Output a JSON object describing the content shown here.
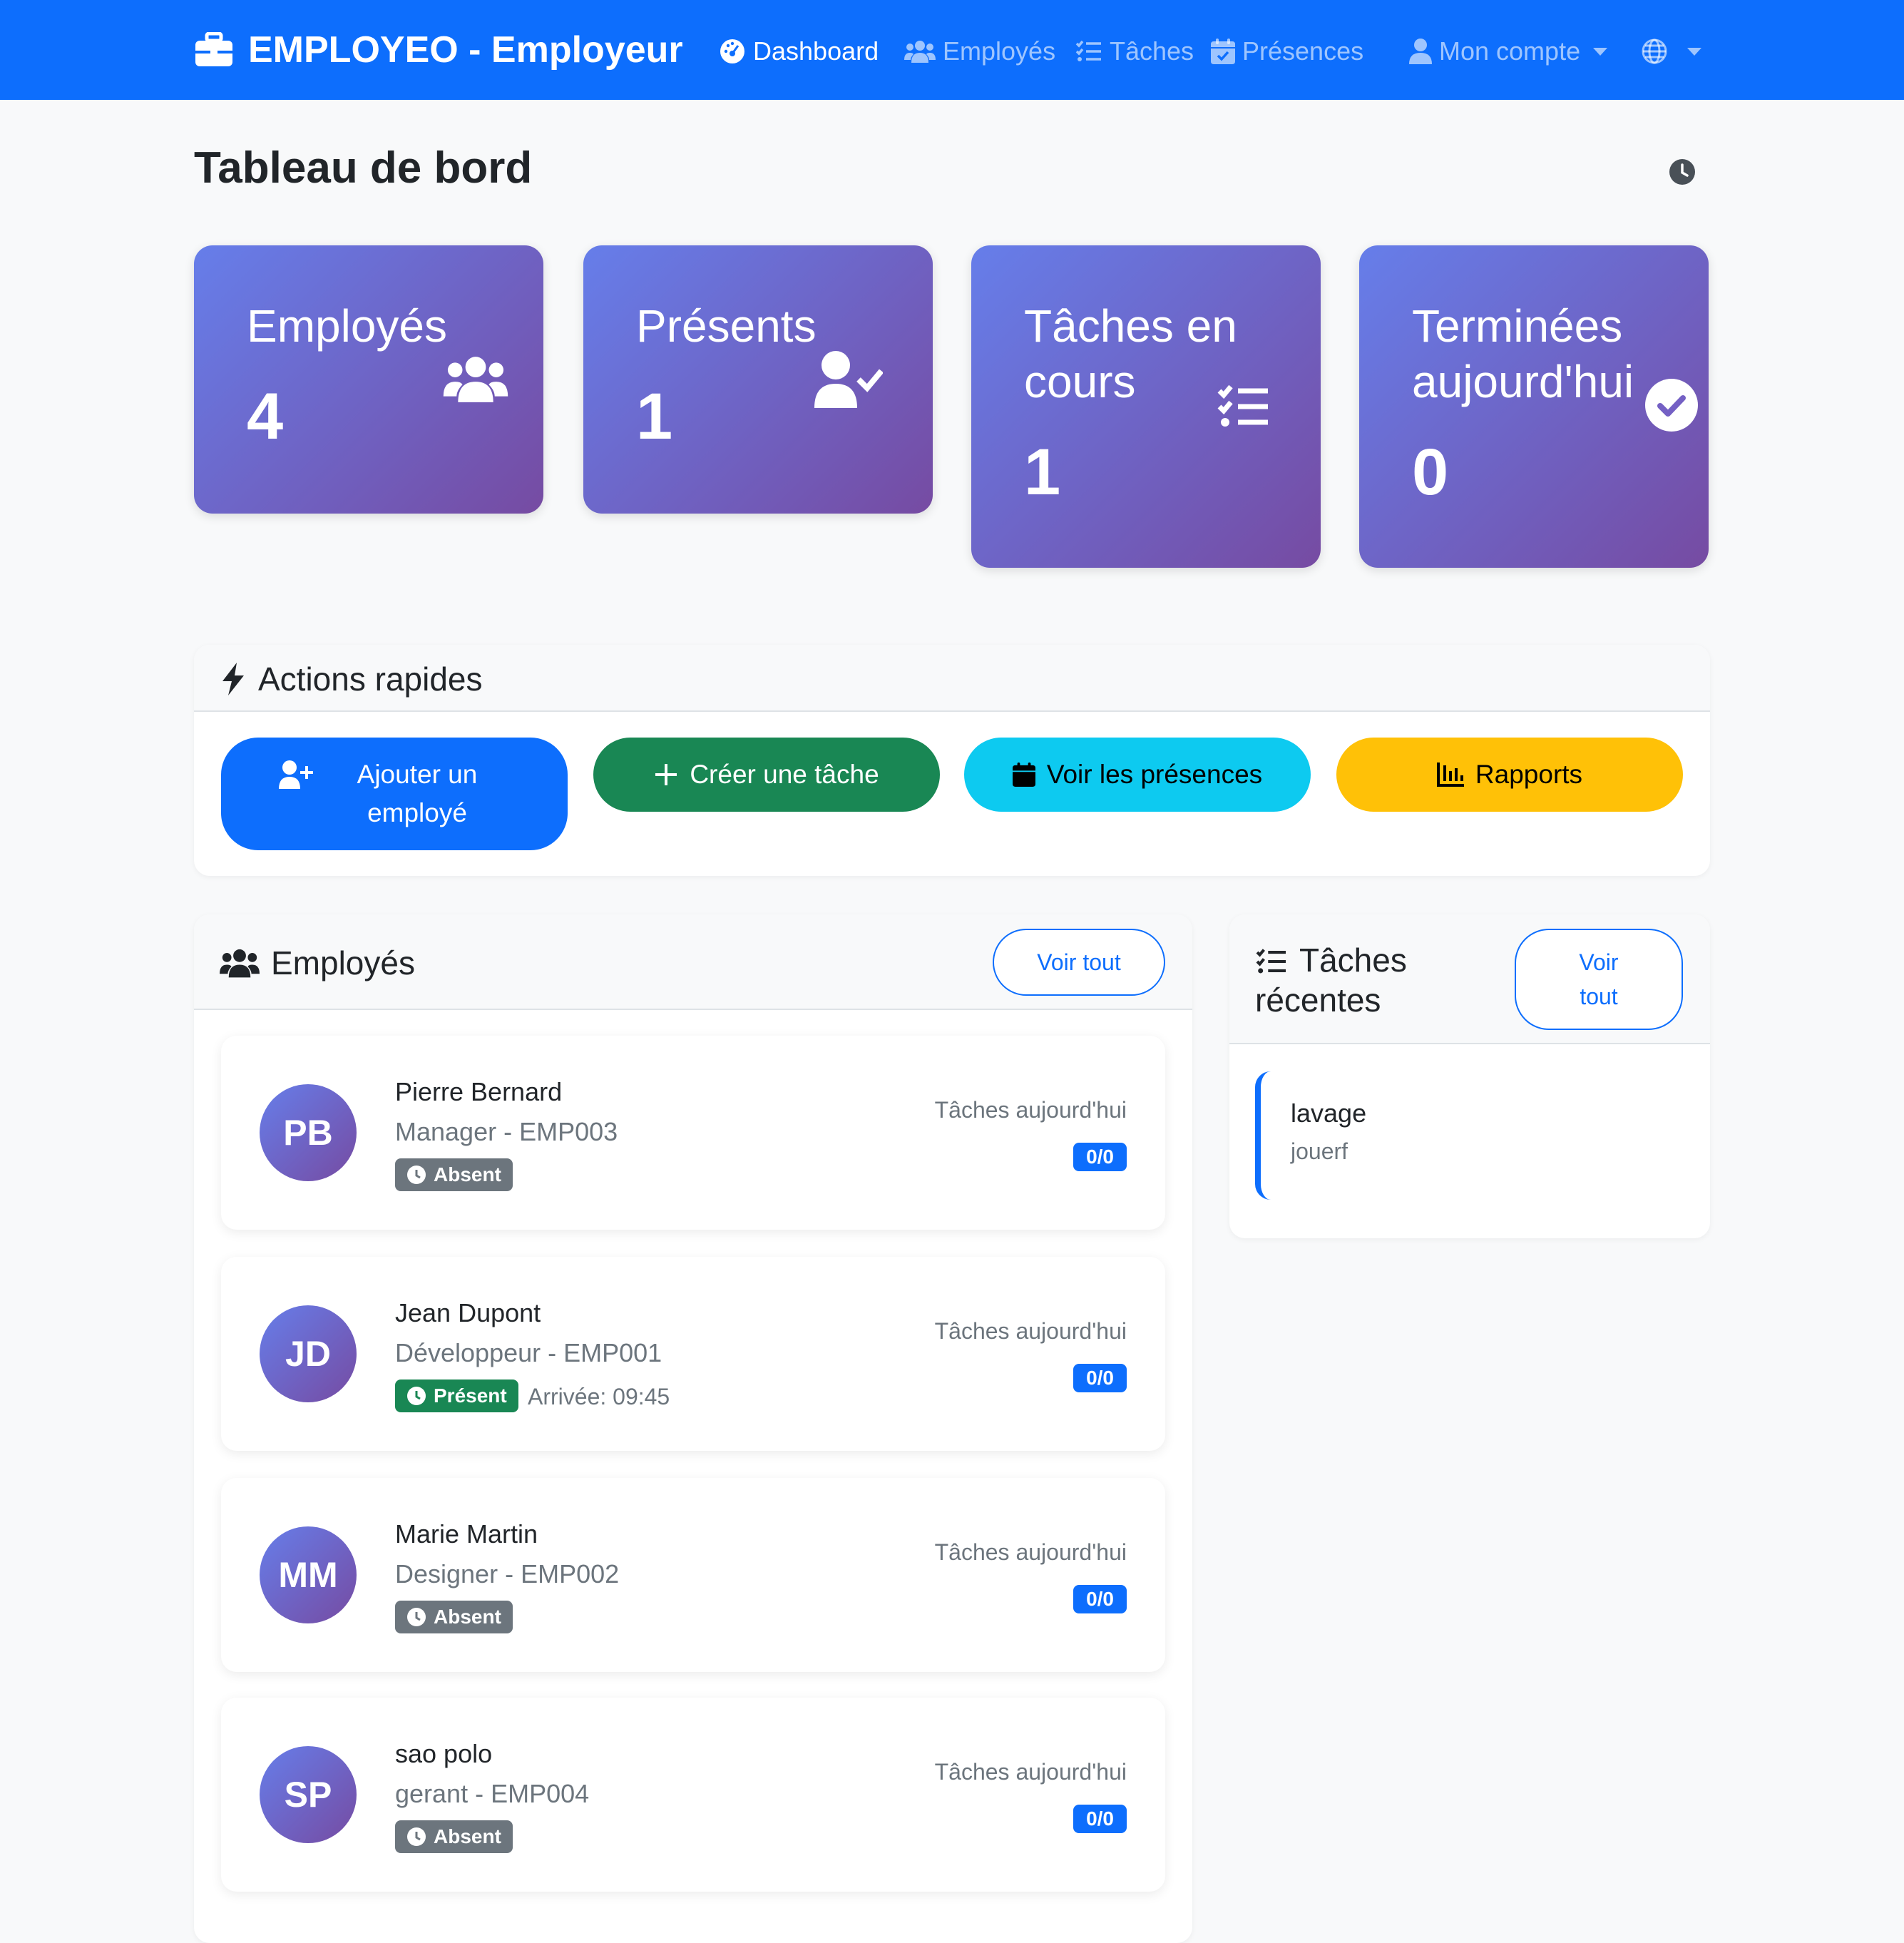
{
  "navbar": {
    "brand": "EMPLOYEO - Employeur",
    "links": [
      {
        "label": "Dashboard",
        "active": true
      },
      {
        "label": "Employés",
        "active": false
      },
      {
        "label": "Tâches",
        "active": false
      },
      {
        "label": "Présences",
        "active": false
      }
    ],
    "account_label": "Mon compte"
  },
  "page": {
    "title": "Tableau de bord"
  },
  "stats": [
    {
      "label": "Employés",
      "value": "4",
      "icon": "users-icon"
    },
    {
      "label": "Présents",
      "value": "1",
      "icon": "user-check-icon"
    },
    {
      "label": "Tâches en cours",
      "value": "1",
      "icon": "tasks-icon"
    },
    {
      "label": "Terminées aujourd'hui",
      "value": "0",
      "icon": "check-circle-icon"
    }
  ],
  "quick_actions": {
    "title": "Actions rapides",
    "buttons": [
      {
        "label": "Ajouter un employé",
        "color": "#0d6efd"
      },
      {
        "label": "Créer une tâche",
        "color": "#198754"
      },
      {
        "label": "Voir les présences",
        "color": "#0dcaf0"
      },
      {
        "label": "Rapports",
        "color": "#ffc107"
      }
    ]
  },
  "employees_panel": {
    "title": "Employés",
    "view_all": "Voir tout",
    "tasks_label": "Tâches aujourd'hui",
    "items": [
      {
        "initials": "PB",
        "name": "Pierre Bernard",
        "role": "Manager - EMP003",
        "status": "Absent",
        "arrival": "",
        "tasks": "0/0"
      },
      {
        "initials": "JD",
        "name": "Jean Dupont",
        "role": "Développeur - EMP001",
        "status": "Présent",
        "arrival": "Arrivée: 09:45",
        "tasks": "0/0"
      },
      {
        "initials": "MM",
        "name": "Marie Martin",
        "role": "Designer - EMP002",
        "status": "Absent",
        "arrival": "",
        "tasks": "0/0"
      },
      {
        "initials": "SP",
        "name": "sao polo",
        "role": "gerant - EMP004",
        "status": "Absent",
        "arrival": "",
        "tasks": "0/0"
      }
    ]
  },
  "recent_tasks": {
    "title_line1": "Tâches",
    "title_line2": "récentes",
    "view_all_line1": "Voir",
    "view_all_line2": "tout",
    "items": [
      {
        "title": "lavage",
        "assignee": "jouerf"
      }
    ]
  },
  "colors": {
    "primary": "#0d6efd",
    "success": "#198754",
    "info": "#0dcaf0",
    "warning": "#ffc107",
    "secondary": "#6c757d",
    "gradient_start": "#667eea",
    "gradient_end": "#764ba2"
  }
}
